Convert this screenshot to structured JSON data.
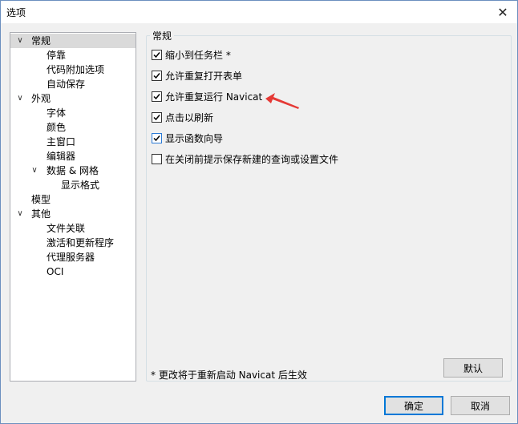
{
  "window": {
    "title": "选项",
    "close_glyph": "✕"
  },
  "tree": {
    "items": [
      {
        "label": "常规",
        "expander": "∨",
        "selected": true
      },
      {
        "label": "停靠"
      },
      {
        "label": "代码附加选项"
      },
      {
        "label": "自动保存"
      },
      {
        "label": "外观",
        "expander": "∨"
      },
      {
        "label": "字体"
      },
      {
        "label": "颜色"
      },
      {
        "label": "主窗口"
      },
      {
        "label": "编辑器"
      },
      {
        "label": "数据 & 网格",
        "expander": "∨"
      },
      {
        "label": "显示格式"
      },
      {
        "label": "模型"
      },
      {
        "label": "其他",
        "expander": "∨"
      },
      {
        "label": "文件关联"
      },
      {
        "label": "激活和更新程序"
      },
      {
        "label": "代理服务器"
      },
      {
        "label": "OCI"
      }
    ]
  },
  "general": {
    "group_title": "常规",
    "options": [
      {
        "label": "缩小到任务栏 *",
        "checked": true
      },
      {
        "label": "允许重复打开表单",
        "checked": true
      },
      {
        "label": "允许重复运行 Navicat",
        "checked": true
      },
      {
        "label": "点击以刷新",
        "checked": true
      },
      {
        "label": "显示函数向导",
        "checked": true
      },
      {
        "label": "在关闭前提示保存新建的查询或设置文件",
        "checked": false
      }
    ],
    "note": "* 更改将于重新启动 Navicat 后生效",
    "default_button": "默认"
  },
  "footer": {
    "ok_button": "确定",
    "cancel_button": "取消"
  },
  "colors": {
    "annotation_arrow": "#e53935",
    "selection": "#dadada",
    "accent": "#0078d7"
  }
}
